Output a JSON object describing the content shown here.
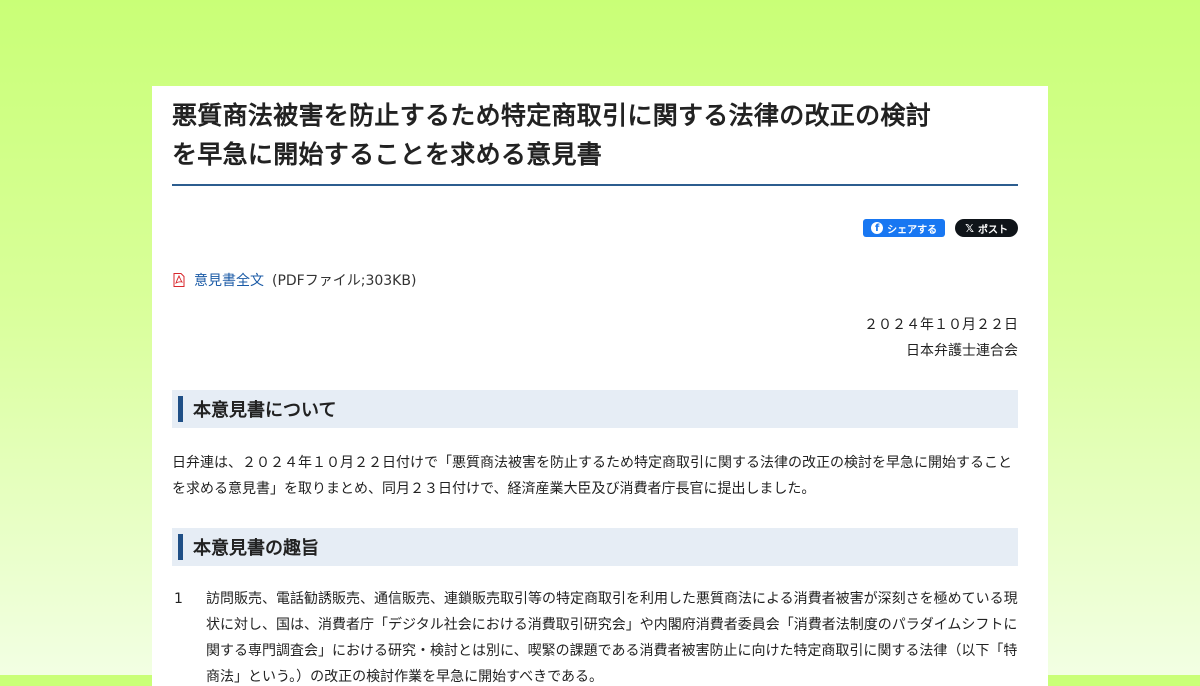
{
  "article": {
    "title_line1": "悪質商法被害を防止するため特定商取引に関する法律の改正の検討",
    "title_line2": "を早急に開始することを求める意見書"
  },
  "share": {
    "facebook_label": "シェアする",
    "x_label": "ポスト",
    "x_glyph": "𝕏",
    "fb_glyph": "f"
  },
  "pdf": {
    "icon": "pdf-icon",
    "link_label": "意見書全文",
    "meta": "(PDFファイル;303KB)"
  },
  "signature": {
    "date": "２０２４年１０月２２日",
    "org": "日本弁護士連合会"
  },
  "sections": [
    {
      "title": "本意見書について",
      "body": "日弁連は、２０２４年１０月２２日付けで「悪質商法被害を防止するため特定商取引に関する法律の改正の検討を早急に開始することを求める意見書」を取りまとめ、同月２３日付けで、経済産業大臣及び消費者庁長官に提出しました。"
    },
    {
      "title": "本意見書の趣旨",
      "items": [
        {
          "num": "1",
          "text": "訪問販売、電話勧誘販売、通信販売、連鎖販売取引等の特定商取引を利用した悪質商法による消費者被害が深刻さを極めている現状に対し、国は、消費者庁「デジタル社会における消費取引研究会」や内閣府消費者委員会「消費者法制度のパラダイムシフトに関する専門調査会」における研究・検討とは別に、喫緊の課題である消費者被害防止に向けた特定商取引に関する法律（以下「特商法」という。）の改正の検討作業を早急に開始すべきである。"
        }
      ]
    }
  ],
  "colors": {
    "accent": "#1f4f86",
    "link": "#1a5aa6",
    "facebook": "#1877f2",
    "x": "#0f1419",
    "pdf_icon": "#d9262b"
  }
}
